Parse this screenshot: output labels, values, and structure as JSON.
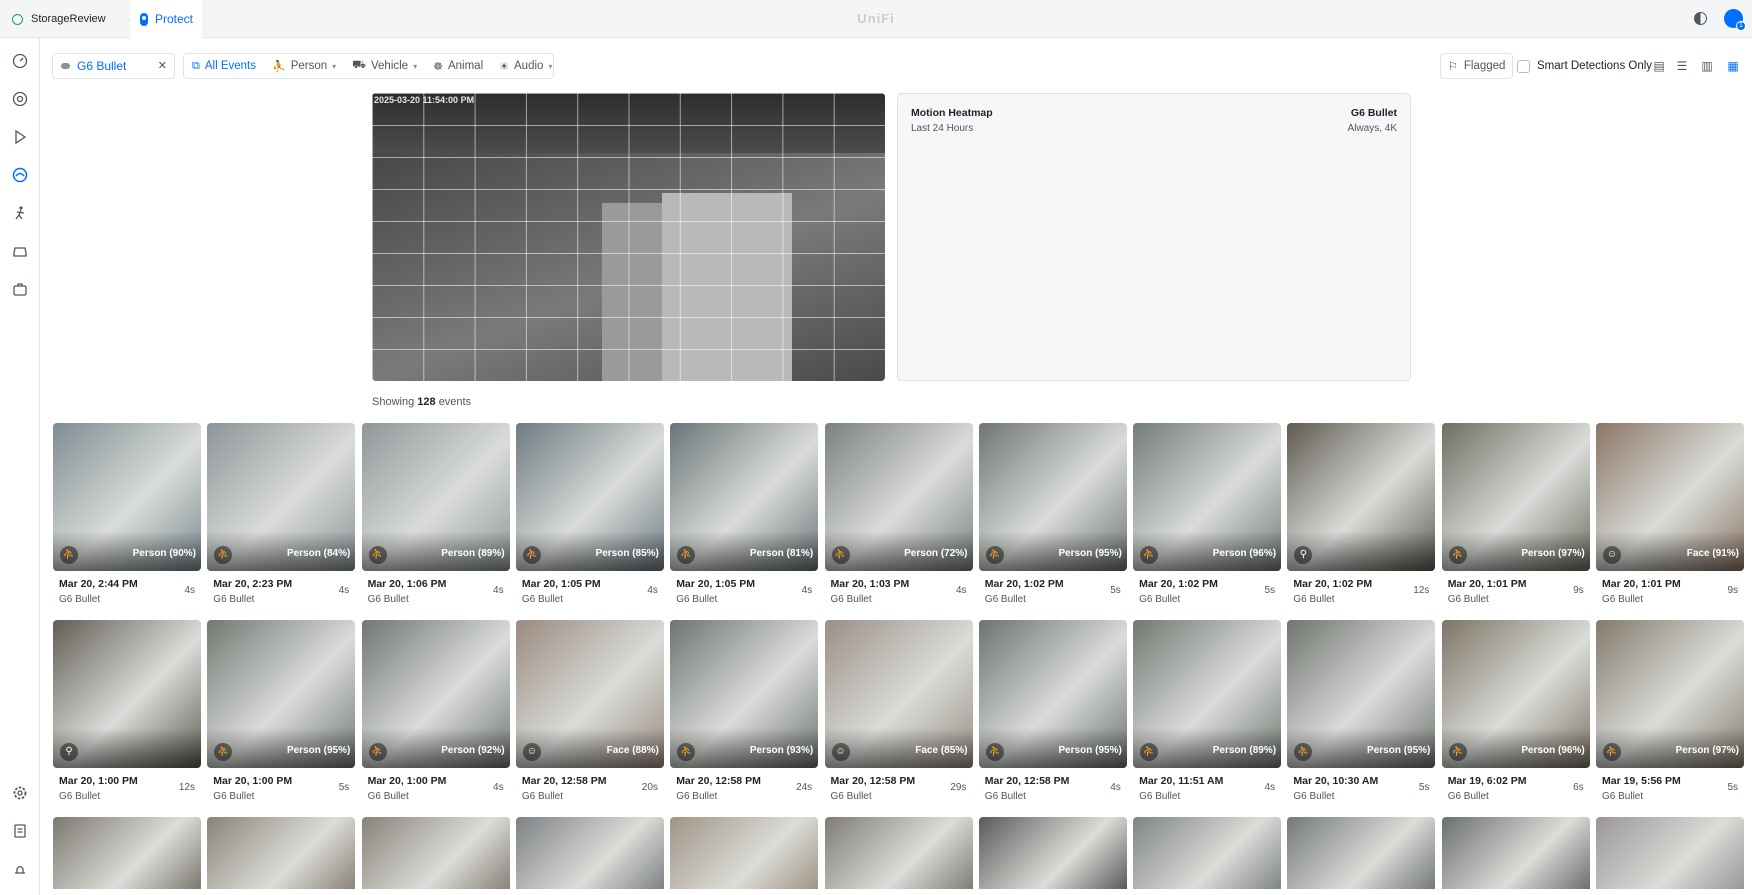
{
  "topbar": {
    "site_name": "StorageReview",
    "app_tab": "Protect",
    "brand": "UniFi",
    "notification_count": "1"
  },
  "sidebar": {
    "items": [
      {
        "name": "dashboard-icon"
      },
      {
        "name": "devices-icon"
      },
      {
        "name": "playback-icon"
      },
      {
        "name": "detections-icon"
      },
      {
        "name": "person-icon"
      },
      {
        "name": "vehicle-icon"
      },
      {
        "name": "toolbox-icon"
      }
    ],
    "bottom": [
      {
        "name": "settings-icon"
      },
      {
        "name": "logs-icon"
      },
      {
        "name": "alerts-icon"
      }
    ]
  },
  "filters": {
    "camera": "G6 Bullet",
    "all_events": "All Events",
    "person": "Person",
    "vehicle": "Vehicle",
    "animal": "Animal",
    "audio": "Audio",
    "flagged": "Flagged",
    "smart_only": "Smart Detections Only"
  },
  "heatmap": {
    "timestamp": "2025-03-20 11:54:00 PM",
    "title": "Motion Heatmap",
    "range": "Last 24 Hours",
    "camera": "G6 Bullet",
    "mode": "Always, 4K"
  },
  "showing": {
    "prefix": "Showing",
    "count": "128",
    "suffix": "events"
  },
  "events_row1": [
    {
      "time": "Mar 20, 2:44 PM",
      "dur": "4s",
      "cam": "G6 Bullet",
      "label": "Person (90%)",
      "type": "person",
      "bg": "#7d8c92"
    },
    {
      "time": "Mar 20, 2:23 PM",
      "dur": "4s",
      "cam": "G6 Bullet",
      "label": "Person (84%)",
      "type": "person",
      "bg": "#8d9398"
    },
    {
      "time": "Mar 20, 1:06 PM",
      "dur": "4s",
      "cam": "G6 Bullet",
      "label": "Person (89%)",
      "type": "person",
      "bg": "#8f9699"
    },
    {
      "time": "Mar 20, 1:05 PM",
      "dur": "4s",
      "cam": "G6 Bullet",
      "label": "Person (85%)",
      "type": "person",
      "bg": "#6e7a82"
    },
    {
      "time": "Mar 20, 1:05 PM",
      "dur": "4s",
      "cam": "G6 Bullet",
      "label": "Person (81%)",
      "type": "person",
      "bg": "#6b7478"
    },
    {
      "time": "Mar 20, 1:03 PM",
      "dur": "4s",
      "cam": "G6 Bullet",
      "label": "Person (72%)",
      "type": "person",
      "bg": "#7a7f81"
    },
    {
      "time": "Mar 20, 1:02 PM",
      "dur": "5s",
      "cam": "G6 Bullet",
      "label": "Person (95%)",
      "type": "person",
      "bg": "#6f7573"
    },
    {
      "time": "Mar 20, 1:02 PM",
      "dur": "5s",
      "cam": "G6 Bullet",
      "label": "Person (96%)",
      "type": "person",
      "bg": "#747b79"
    },
    {
      "time": "Mar 20, 1:02 PM",
      "dur": "12s",
      "cam": "G6 Bullet",
      "label": "",
      "type": "motion",
      "bg": "#5f5a52"
    },
    {
      "time": "Mar 20, 1:01 PM",
      "dur": "9s",
      "cam": "G6 Bullet",
      "label": "Person (97%)",
      "type": "person",
      "bg": "#6e6e62"
    },
    {
      "time": "Mar 20, 1:01 PM",
      "dur": "9s",
      "cam": "G6 Bullet",
      "label": "Face (91%)",
      "type": "face",
      "bg": "#8a7566"
    }
  ],
  "events_row2": [
    {
      "time": "Mar 20, 1:00 PM",
      "dur": "12s",
      "cam": "G6 Bullet",
      "label": "",
      "type": "motion",
      "bg": "#625d55"
    },
    {
      "time": "Mar 20, 1:00 PM",
      "dur": "5s",
      "cam": "G6 Bullet",
      "label": "Person (95%)",
      "type": "person",
      "bg": "#737873"
    },
    {
      "time": "Mar 20, 1:00 PM",
      "dur": "4s",
      "cam": "G6 Bullet",
      "label": "Person (92%)",
      "type": "person",
      "bg": "#717672"
    },
    {
      "time": "Mar 20, 12:58 PM",
      "dur": "20s",
      "cam": "G6 Bullet",
      "label": "Face (88%)",
      "type": "face",
      "bg": "#9a8a80"
    },
    {
      "time": "Mar 20, 12:58 PM",
      "dur": "24s",
      "cam": "G6 Bullet",
      "label": "Person (93%)",
      "type": "person",
      "bg": "#6f7470"
    },
    {
      "time": "Mar 20, 12:58 PM",
      "dur": "29s",
      "cam": "G6 Bullet",
      "label": "Face (85%)",
      "type": "face",
      "bg": "#9b8e86"
    },
    {
      "time": "Mar 20, 12:58 PM",
      "dur": "4s",
      "cam": "G6 Bullet",
      "label": "Person (95%)",
      "type": "person",
      "bg": "#6d7370"
    },
    {
      "time": "Mar 20, 11:51 AM",
      "dur": "4s",
      "cam": "G6 Bullet",
      "label": "Person (89%)",
      "type": "person",
      "bg": "#727772"
    },
    {
      "time": "Mar 20, 10:30 AM",
      "dur": "5s",
      "cam": "G6 Bullet",
      "label": "Person (95%)",
      "type": "person",
      "bg": "#70746f"
    },
    {
      "time": "Mar 19, 6:02 PM",
      "dur": "6s",
      "cam": "G6 Bullet",
      "label": "Person (96%)",
      "type": "person",
      "bg": "#7e7466"
    },
    {
      "time": "Mar 19, 5:56 PM",
      "dur": "5s",
      "cam": "G6 Bullet",
      "label": "Person (97%)",
      "type": "person",
      "bg": "#857b6d"
    }
  ],
  "events_row3_colors": [
    "#7c7870",
    "#8a8378",
    "#88827a",
    "#7d8184",
    "#a09486",
    "#7f7c76",
    "#5a5a5a",
    "#7e8486",
    "#73787a",
    "#6b6f70",
    "#9a9698"
  ]
}
